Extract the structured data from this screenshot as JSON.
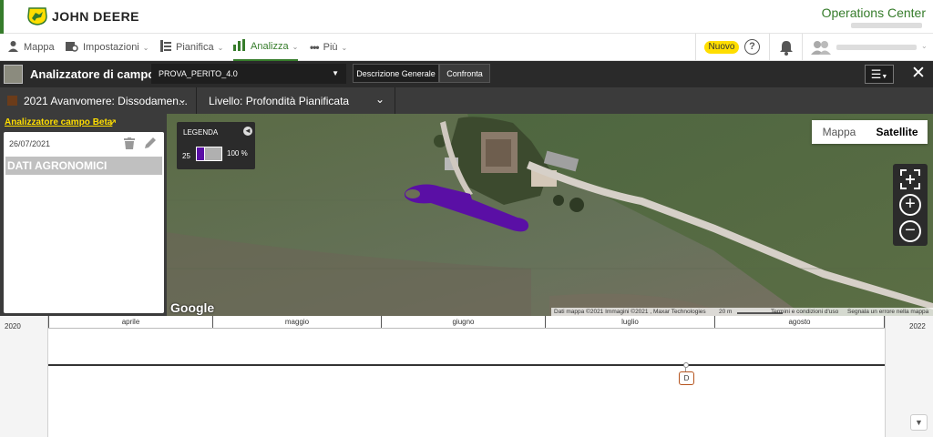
{
  "header": {
    "brand": "JOHN DEERE",
    "app_title": "Operations Center",
    "colors": {
      "brand_green": "#367c2b",
      "brand_yellow": "#ffde00"
    }
  },
  "nav": {
    "items": [
      {
        "label": "Mappa",
        "icon": "person-pin-icon",
        "has_dropdown": false
      },
      {
        "label": "Impostazioni",
        "icon": "settings-icon",
        "has_dropdown": true
      },
      {
        "label": "Pianifica",
        "icon": "plan-icon",
        "has_dropdown": true
      },
      {
        "label": "Analizza",
        "icon": "bar-chart-icon",
        "has_dropdown": true,
        "active": true
      },
      {
        "label": "Più",
        "icon": "more-dots-icon",
        "has_dropdown": true
      }
    ],
    "new_badge": "Nuovo",
    "help_glyph": "?"
  },
  "toolbar": {
    "title": "Analizzatore di campo",
    "field_select": "PROVA_PERITO_4.0",
    "buttons": [
      "Descrizione Generale",
      "Confronta"
    ]
  },
  "filters": {
    "crop": "2021 Avanvomere: Dissodamen...",
    "level": "Livello: Profondità Pianificata"
  },
  "left_panel": {
    "beta_link": "Analizzatore campo Beta",
    "card_date": "26/07/2021",
    "section": "DATI AGRONOMICI"
  },
  "map": {
    "legend": {
      "title": "LEGENDA",
      "min": "25",
      "max": "100 %",
      "fill_color": "#5a0fa5"
    },
    "map_type": [
      "Mappa",
      "Satellite"
    ],
    "selected_map_type": "Satellite",
    "google": "Google",
    "attribution": {
      "data": "Dati mappa ©2021 Immagini ©2021 , Maxar Technologies",
      "scale": "20 m",
      "terms": "Termini e condizioni d'uso",
      "report": "Segnala un errore nella mappa"
    }
  },
  "timeline": {
    "year_start": "2020",
    "year_end": "2022",
    "months": [
      "aprile",
      "maggio",
      "giugno",
      "luglio",
      "agosto"
    ],
    "marker": "D"
  }
}
